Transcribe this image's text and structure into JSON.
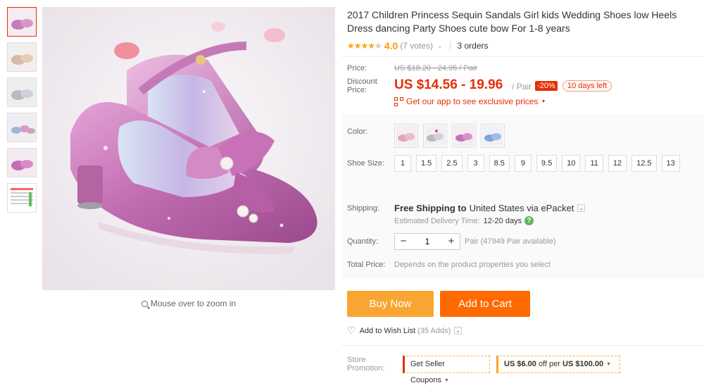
{
  "product": {
    "title": "2017 Children Princess Sequin Sandals Girl kids Wedding Shoes low Heels Dress dancing Party Shoes cute bow For 1-8 years",
    "rating_stars": "★★★★",
    "rating_half": "★",
    "rating": "4.0",
    "votes": "(7 votes)",
    "orders": "3 orders"
  },
  "gallery": {
    "zoom_hint": "Mouse over to zoom in",
    "thumb_count": 6
  },
  "price": {
    "price_label": "Price:",
    "original": "US $18.20 - 24.95 / Pair",
    "discount_label_1": "Discount",
    "discount_label_2": "Price:",
    "discount_price": "US $14.56 - 19.96",
    "unit": "/ Pair",
    "discount_pct": "-20%",
    "days_left": "10 days left",
    "app_promo": "Get our app to see exclusive prices"
  },
  "options": {
    "color_label": "Color:",
    "colors": [
      "pink-gold",
      "silver",
      "purple",
      "blue"
    ],
    "size_label": "Shoe Size:",
    "sizes": [
      "1",
      "1.5",
      "2.5",
      "3",
      "8.5",
      "9",
      "9.5",
      "10",
      "11",
      "12",
      "12.5",
      "13"
    ]
  },
  "shipping": {
    "label": "Shipping:",
    "free": "Free Shipping to",
    "destination": "United States via ePacket",
    "est_label": "Estimated Delivery Time:",
    "est_value": "12-20 days"
  },
  "quantity": {
    "label": "Quantity:",
    "value": "1",
    "available": "Pair (47949 Pair available)"
  },
  "total": {
    "label": "Total Price:",
    "note": "Depends on the product properties you select"
  },
  "actions": {
    "buy_now": "Buy Now",
    "add_to_cart": "Add to Cart",
    "wish_label": "Add to Wish List",
    "wish_count": "(35 Adds)"
  },
  "promotion": {
    "label_1": "Store",
    "label_2": "Promotion:",
    "seller_coupons": "Get Seller Coupons",
    "coupon_off": "US $6.00",
    "coupon_mid": "off per",
    "coupon_min": "US $100.00"
  },
  "colors": {
    "accent_red": "#e62e04",
    "buy_orange": "#f8a631",
    "cart_orange": "#ff6a00",
    "star": "#ffa500"
  }
}
